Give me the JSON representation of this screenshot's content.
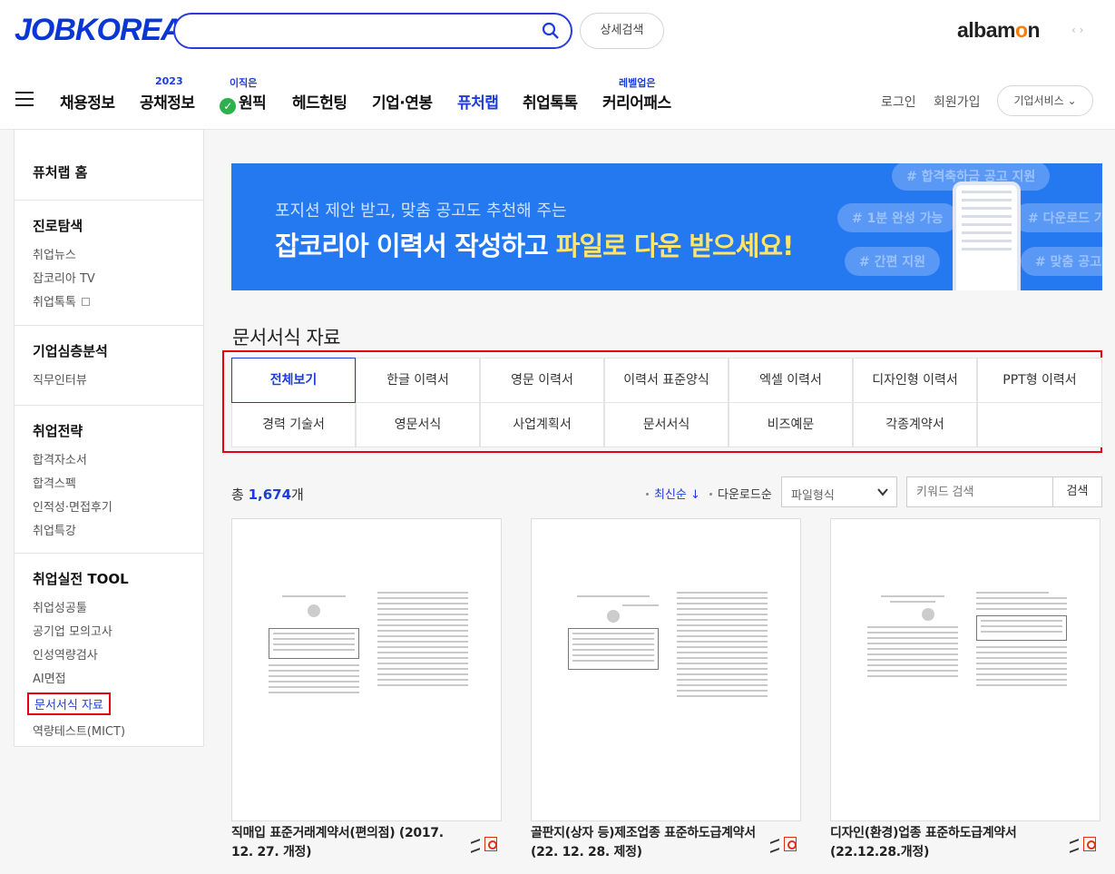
{
  "header": {
    "logo": "JOBKOREA",
    "search_placeholder": "",
    "detail_search": "상세검색",
    "partner_logo_a": "alba",
    "partner_logo_o": "m",
    "partner_logo_b": "n",
    "partner_arrows": "‹ ›"
  },
  "gnb": {
    "items": [
      {
        "label": "채용정보"
      },
      {
        "label": "공채정보",
        "sup": "2023"
      },
      {
        "label": "원픽",
        "sup": "이직은"
      },
      {
        "label": "헤드헌팅"
      },
      {
        "label": "기업·연봉"
      },
      {
        "label": "퓨처랩"
      },
      {
        "label": "취업톡톡"
      },
      {
        "label": "커리어패스",
        "sup": "레벨업은"
      }
    ],
    "login": "로그인",
    "signup": "회원가입",
    "biz_service": "기업서비스"
  },
  "sidebar": {
    "home": "퓨처랩 홈",
    "sections": [
      {
        "title": "진로탐색",
        "links": [
          "취업뉴스",
          "잡코리아 TV",
          "취업톡톡"
        ]
      },
      {
        "title": "기업심층분석",
        "links": [
          "직무인터뷰"
        ]
      },
      {
        "title": "취업전략",
        "links": [
          "합격자소서",
          "합격스펙",
          "인적성·면접후기",
          "취업특강"
        ]
      },
      {
        "title": "취업실전 TOOL",
        "links": [
          "취업성공툴",
          "공기업 모의고사",
          "인성역량검사",
          "AI면접",
          "문서서식 자료",
          "역량테스트(MICT)"
        ]
      }
    ]
  },
  "banner": {
    "sub": "포지션 제안 받고, 맞춤 공고도 추천해 주는",
    "main_a": "잡코리아 이력서 작성하고 ",
    "main_b": "파일로 다운 받으세요!",
    "tags": [
      "# 합격축하금 공고 지원",
      "# 1분 완성 가능",
      "# 다운로드 가능",
      "# 간편 지원",
      "# 맞춤 공고 추천"
    ]
  },
  "main": {
    "title": "문서서식 자료",
    "categories": [
      "전체보기",
      "한글 이력서",
      "영문 이력서",
      "이력서 표준양식",
      "엑셀 이력서",
      "디자인형 이력서",
      "PPT형 이력서",
      "경력 기술서",
      "영문서식",
      "사업계획서",
      "문서서식",
      "비즈예문",
      "각종계약서"
    ],
    "total_prefix": "총 ",
    "total_count": "1,674",
    "total_suffix": "개",
    "sort_latest": "최신순 ↓",
    "sort_download": "다운로드순",
    "file_type": "파일형식",
    "keyword_placeholder": "키워드 검색",
    "search_button": "검색"
  },
  "cards": [
    {
      "title": "직매입 표준거래계약서(편의점) (2017. 12. 27. 개정)"
    },
    {
      "title": "골판지(상자 등)제조업종 표준하도급계약서 (22. 12. 28. 제정)"
    },
    {
      "title": "디자인(환경)업종 표준하도급계약서 (22.12.28.개정)"
    }
  ],
  "colors": {
    "brand": "#1c3ddb",
    "highlight_box": "#e60012",
    "banner": "#2478f0"
  }
}
